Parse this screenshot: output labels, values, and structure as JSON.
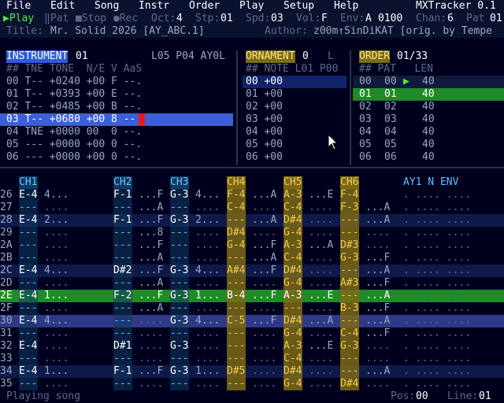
{
  "menu": [
    "File",
    "Edit",
    "Song",
    "Instr",
    "Order",
    "Play",
    "Setup",
    "Help"
  ],
  "app_title": "MXTracker 0.1",
  "status": {
    "play": "▶Play",
    "pat": "‖Pat",
    "stop": "■Stop",
    "rec": "●Rec",
    "oct_label": "Oct:",
    "oct": "4",
    "stp_label": "Stp:",
    "stp": "01",
    "spd_label": "Spd:",
    "spd": "03",
    "vol_label": "Vol:",
    "vol": "F",
    "env_label": "Env:",
    "env": "A",
    "env_val": "0100",
    "chan_label": "Chan:",
    "chan": "6",
    "pat_label": "Pat",
    "pat_val": "01"
  },
  "song": {
    "title_label": "Title:",
    "title": "Mr. Solid 2026 [AY_ABC.1]",
    "author_label": "Author:",
    "author": "z00m↑SinDiKAT [orig. by Tempe"
  },
  "instrument": {
    "header": "INSTRUMENT",
    "num": "01",
    "l_info": "L05 P04 AY0L",
    "col_headers": "## TNE TONE  N/E V AaS",
    "rows": [
      "00 T-- +0240 +00 F --.",
      "01 T-- +0393 +00 E --.",
      "02 T-- +0485 +00 B --.",
      "03 T-- +0680 +00 8 --",
      "04 TNE +0000 00  0 --.",
      "05 --- +0000 +00 0 --.",
      "06 --- +0000 +00 0 --."
    ]
  },
  "ornament": {
    "header": "ORNAMENT",
    "num": "0",
    "l": "L",
    "col_headers": "## NOTE L01 P00",
    "rows": [
      "00 +00",
      "01 +00",
      "02 +00",
      "03 +00",
      "04 +00",
      "05 +00",
      "06 +00"
    ]
  },
  "order": {
    "header": "ORDER",
    "pos": "01/33",
    "col_headers": "## PAT   LEN",
    "rows": [
      {
        "n": "00",
        "p": "00",
        "l": "40",
        "mark": "▶"
      },
      {
        "n": "01",
        "p": "01",
        "l": "40",
        "mark": ""
      },
      {
        "n": "02",
        "p": "02",
        "l": "40",
        "mark": ""
      },
      {
        "n": "03",
        "p": "03",
        "l": "40",
        "mark": ""
      },
      {
        "n": "04",
        "p": "04",
        "l": "40",
        "mark": ""
      },
      {
        "n": "05",
        "p": "05",
        "l": "40",
        "mark": ""
      },
      {
        "n": "06",
        "p": "06",
        "l": "40",
        "mark": ""
      }
    ]
  },
  "pattern": {
    "channels": [
      "CH1",
      "CH2",
      "CH3",
      "CH4",
      "CH5",
      "CH6"
    ],
    "extra_header": "AY1 N ENV",
    "rows": [
      {
        "n": "26",
        "c": [
          "E-4",
          "4...",
          "F-1",
          "...F",
          "G-3",
          "4...",
          "F-4",
          "...A",
          "A-3",
          "...E",
          "F-4",
          ""
        ],
        "x": ". .... ...."
      },
      {
        "n": "27",
        "c": [
          "---",
          "....",
          "---",
          "...A",
          "---",
          "....",
          "C-4",
          "....",
          "C-4",
          "....",
          "F-3",
          "...A"
        ],
        "x": ". .... ...."
      },
      {
        "n": "28",
        "c": [
          "E-4",
          "2...",
          "F-1",
          "...F",
          "G-3",
          "2...",
          "---",
          "...A",
          "D#4",
          "....",
          "---",
          "...A"
        ],
        "x": ". .... ...."
      },
      {
        "n": "29",
        "c": [
          "---",
          "....",
          "---",
          "...8",
          "---",
          "....",
          "D#4",
          "....",
          "G-4",
          "....",
          "---",
          "...."
        ],
        "x": ". .... ...."
      },
      {
        "n": "2A",
        "c": [
          "---",
          "....",
          "---",
          "...F",
          "---",
          "....",
          "G-4",
          "...F",
          "A-3",
          "...A",
          "D#3",
          "...."
        ],
        "x": ". .... ...."
      },
      {
        "n": "2B",
        "c": [
          "---",
          "....",
          "---",
          "...A",
          "---",
          "....",
          "---",
          "...A",
          "C-4",
          "....",
          "G-3",
          "...F"
        ],
        "x": ". .... ...."
      },
      {
        "n": "2C",
        "c": [
          "E-4",
          "4...",
          "D#2",
          "...F",
          "G-3",
          "4...",
          "A#4",
          "...F",
          "D#4",
          "....",
          "---",
          "...A"
        ],
        "x": ". .... ...."
      },
      {
        "n": "2D",
        "c": [
          "---",
          "....",
          "---",
          "...A",
          "---",
          "....",
          "---",
          "....",
          "G-4",
          "....",
          "A#3",
          "...F"
        ],
        "x": ". .... ...."
      },
      {
        "n": "2E",
        "c": [
          "E-4",
          "1...",
          "F-2",
          "...F",
          "G-3",
          "1...",
          "B-4",
          "...F",
          "A-3",
          "...E",
          "---",
          "...A"
        ],
        "x": ". .... ...."
      },
      {
        "n": "2F",
        "c": [
          "---",
          "....",
          "---",
          "...A",
          "---",
          "....",
          "---",
          "....",
          "---",
          "....",
          "B-3",
          "...F"
        ],
        "x": ". .... ...."
      },
      {
        "n": "30",
        "c": [
          "E-4",
          "4...",
          "---",
          "....",
          "G-3",
          "4...",
          "C-5",
          "...F",
          "D#4",
          "...A",
          "---",
          "...A"
        ],
        "x": ". .... ...."
      },
      {
        "n": "31",
        "c": [
          "---",
          "....",
          "---",
          "....",
          "---",
          "....",
          "---",
          "....",
          "G-4",
          "....",
          "C-4",
          "...F"
        ],
        "x": ". .... ...."
      },
      {
        "n": "32",
        "c": [
          "E-4",
          "....",
          "D#1",
          "....",
          "G-3",
          "....",
          "---",
          "....",
          "A-3",
          "...E",
          "G-3",
          "...."
        ],
        "x": ". .... ...."
      },
      {
        "n": "33",
        "c": [
          "---",
          "....",
          "---",
          "....",
          "---",
          "....",
          "---",
          "....",
          "C-4",
          "....",
          "---",
          "...."
        ],
        "x": ". .... ...."
      },
      {
        "n": "34",
        "c": [
          "E-4",
          "1...",
          "F-1",
          "...F",
          "G-3",
          "1...",
          "D#5",
          "....",
          "D#4",
          "....",
          "---",
          "...A"
        ],
        "x": ". .... ...."
      },
      {
        "n": "35",
        "c": [
          "---",
          "....",
          "---",
          "....",
          "---",
          "....",
          "---",
          "....",
          "G-4",
          "....",
          "D#4",
          "...."
        ],
        "x": ". .... ...."
      }
    ]
  },
  "footer": {
    "status": "Playing song",
    "pos_label": "Pos:",
    "pos": "00",
    "line_label": "Line:",
    "line": "01"
  },
  "colors": {
    "accent": "#2f5bd8",
    "play_green": "#1f8a27",
    "note_yellow": "#f2c94c",
    "note_cyan": "#58c4ff"
  }
}
